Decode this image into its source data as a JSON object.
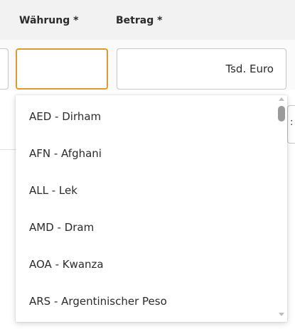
{
  "header": {
    "currency_label": "Währung *",
    "amount_label": "Betrag *"
  },
  "currency_field": {
    "value": "",
    "placeholder": ""
  },
  "amount_field": {
    "unit": "Tsd. Euro"
  },
  "right_edge_field": {
    "visible_fragment": ":"
  },
  "dropdown": {
    "options": [
      "AED - Dirham",
      "AFN - Afghani",
      "ALL - Lek",
      "AMD - Dram",
      "AOA - Kwanza",
      "ARS - Argentinischer Peso"
    ]
  },
  "colors": {
    "focus_border": "#e09a2b",
    "header_background": "#f2f2f2",
    "field_border": "#c6c6c6",
    "scroll_thumb": "#9a9a9a"
  }
}
